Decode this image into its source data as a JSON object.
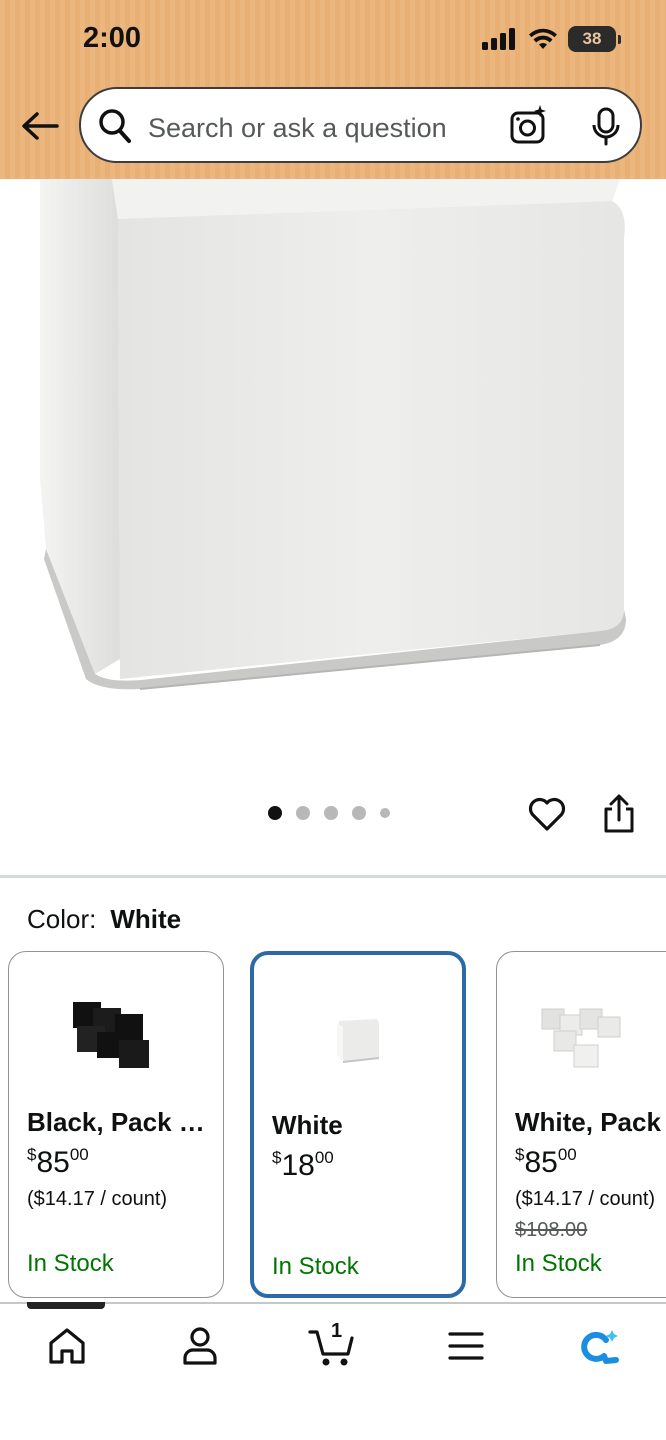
{
  "status_bar": {
    "time": "2:00",
    "battery": "38"
  },
  "search": {
    "placeholder": "Search or ask a question"
  },
  "carousel": {
    "total": 5,
    "active": 1
  },
  "color": {
    "label": "Color:",
    "value": "White"
  },
  "variants": [
    {
      "name": "Black, Pack …",
      "price_dollars": "85",
      "price_cents": "00",
      "unit_price": "($14.17 / count)",
      "list_price": "",
      "stock": "In Stock",
      "selected": false
    },
    {
      "name": "White",
      "price_dollars": "18",
      "price_cents": "00",
      "unit_price": "",
      "list_price": "",
      "stock": "In Stock",
      "selected": true
    },
    {
      "name": "White, Pack",
      "price_dollars": "85",
      "price_cents": "00",
      "unit_price": "($14.17 / count)",
      "list_price": "$108.00",
      "stock": "In Stock",
      "selected": false
    }
  ],
  "price_symbol": "$",
  "bottom_nav": {
    "cart_count": "1",
    "items": [
      "home-icon",
      "account-icon",
      "cart-icon",
      "menu-icon",
      "rufus-icon"
    ]
  },
  "colors": {
    "header": "#ecb77e",
    "stock": "#007600",
    "selected_border": "#2a6aa8",
    "ai_icon": "#1a8ee0"
  }
}
